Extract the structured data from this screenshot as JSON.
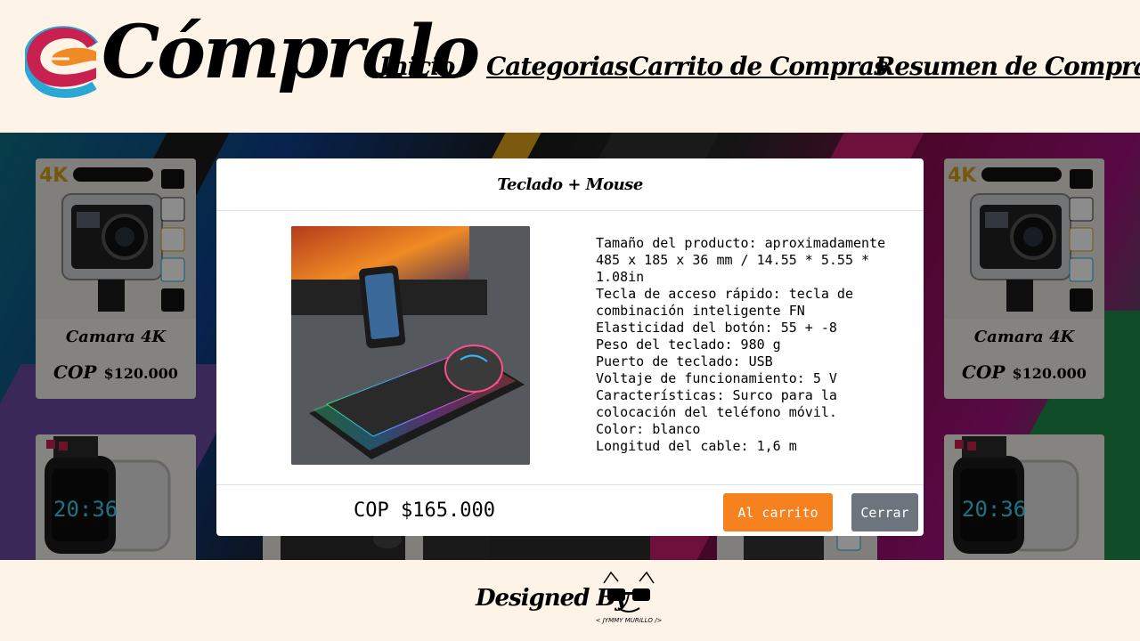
{
  "brand": {
    "name": "Cómpralo"
  },
  "nav": {
    "items": [
      {
        "label": "Inicio"
      },
      {
        "label": "Categorias"
      },
      {
        "label": "Carrito de Compras"
      },
      {
        "label": "Resumen de Compras"
      }
    ]
  },
  "products": [
    {
      "title": "Camara 4K",
      "currency": "COP",
      "price": "$120.000"
    },
    {
      "title": "Camara 4K",
      "currency": "COP",
      "price": "$120.000"
    }
  ],
  "modal": {
    "title": "Teclado + Mouse",
    "description": [
      "Tamaño del producto: aproximadamente 485 x 185 x 36 mm / 14.55 * 5.55 * 1.08in",
      "Tecla de acceso rápido: tecla de combinación inteligente FN",
      "Elasticidad del botón: 55 + -8",
      "Peso del teclado: 980 g",
      "Puerto de teclado: USB",
      "Voltaje de funcionamiento: 5 V",
      "Características: Surco para la colocación del teléfono móvil.",
      "Color: blanco",
      "Longitud del cable: 1,6 m"
    ],
    "price": "COP $165.000",
    "add_to_cart_label": "Al carrito",
    "close_label": "Cerrar"
  },
  "footer": {
    "designed_by": "Designed By",
    "author_logo_text": "< JYMMY MURILLO />"
  },
  "colors": {
    "background": "#fdf3e7",
    "cart_button": "#f5811f",
    "close_button": "#6c757d",
    "logo_red": "#c8214f",
    "logo_orange": "#f08a24",
    "logo_blue": "#2ba7d6"
  }
}
